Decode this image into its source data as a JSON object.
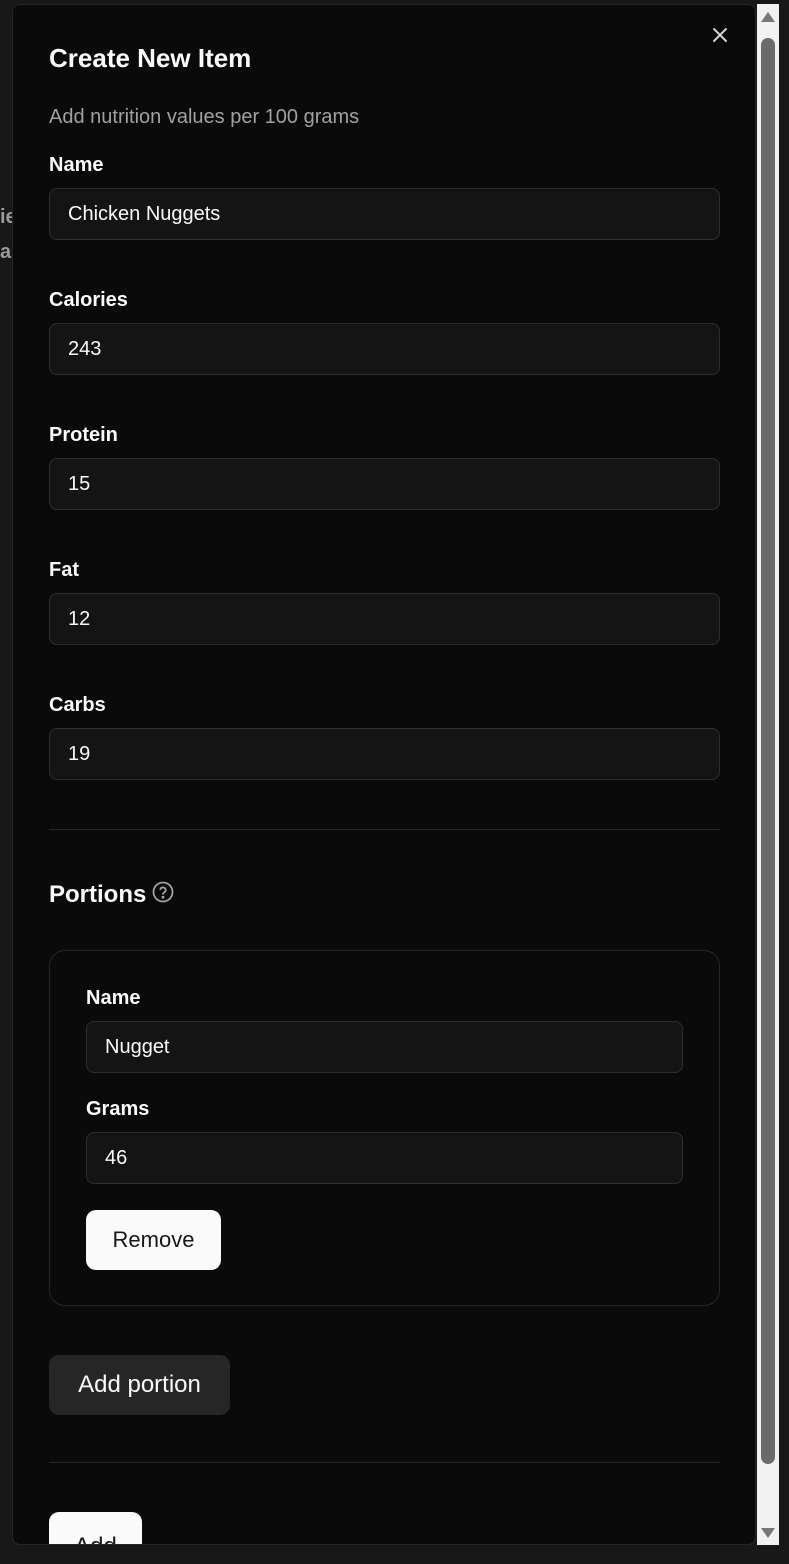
{
  "background": {
    "fragment_1": "ie",
    "fragment_2": "a"
  },
  "dialog": {
    "title": "Create New Item",
    "subtitle": "Add nutrition values per 100 grams",
    "close_icon": "close-icon"
  },
  "fields": {
    "name": {
      "label": "Name",
      "value": "Chicken Nuggets"
    },
    "calories": {
      "label": "Calories",
      "value": "243"
    },
    "protein": {
      "label": "Protein",
      "value": "15"
    },
    "fat": {
      "label": "Fat",
      "value": "12"
    },
    "carbs": {
      "label": "Carbs",
      "value": "19"
    }
  },
  "portions": {
    "title": "Portions",
    "help_icon": "help-circle-icon",
    "items": [
      {
        "name_label": "Name",
        "name_value": "Nugget",
        "grams_label": "Grams",
        "grams_value": "46",
        "remove_label": "Remove"
      }
    ],
    "add_label": "Add portion"
  },
  "footer": {
    "submit_label": "Add"
  },
  "colors": {
    "background": "#0a0a0a",
    "input_bg": "#141414",
    "border": "#262626",
    "primary_button": "#fafafa",
    "secondary_button": "#262626"
  }
}
